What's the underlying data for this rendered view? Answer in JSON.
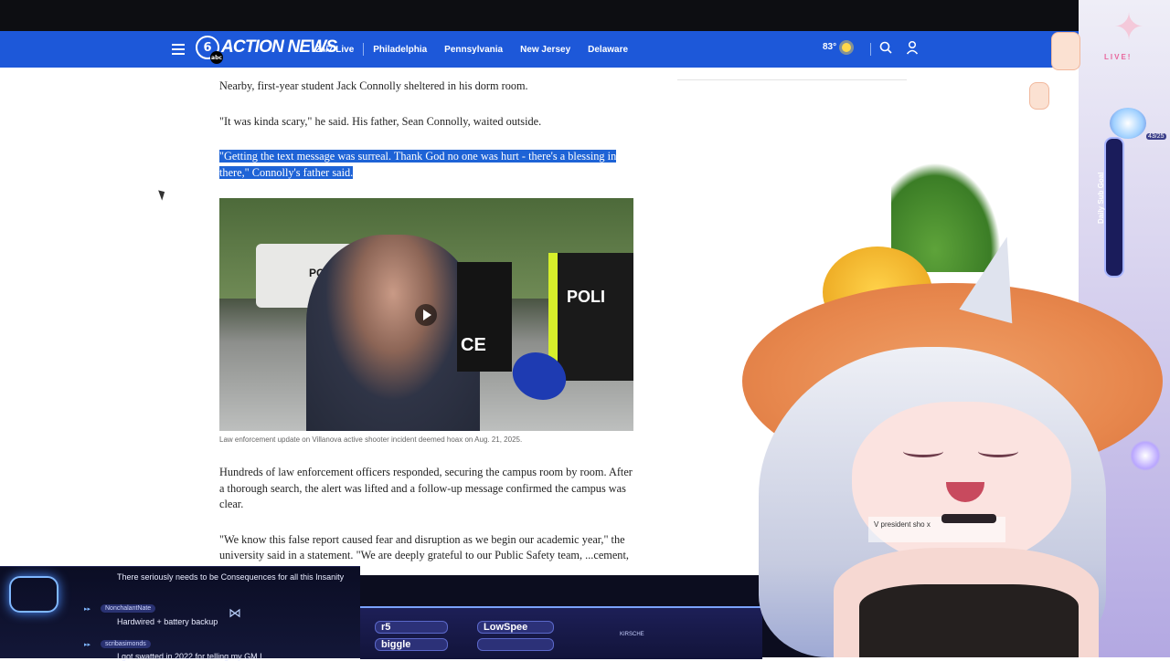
{
  "nav": {
    "logo_number": "6",
    "logo_sub": "abc",
    "logo_text": "ACTION NEWS",
    "links": [
      "24/7 Live",
      "Philadelphia",
      "Pennsylvania",
      "New Jersey",
      "Delaware"
    ],
    "temperature": "83°",
    "colors": {
      "nav_bg": "#1d58d9",
      "highlight": "#1e63d6"
    }
  },
  "article": {
    "p1": "Nearby, first-year student Jack Connolly sheltered in his dorm room.",
    "p2": "\"It was kinda scary,\" he said. His father, Sean Connolly, waited outside.",
    "p3_highlighted": "\"Getting the text message was surreal. Thank God no one was hurt - there's a blessing in there,\" Connolly's father said.",
    "caption": "Law enforcement update on Villanova active shooter incident deemed hoax on Aug. 21, 2025.",
    "video_sign_1": "POLICE",
    "video_sign_2": "POLI",
    "video_sign_3": "CE",
    "p4": "Hundreds of law enforcement officers responded, securing the campus room by room. After a thorough search, the alert was lifted and a follow-up message confirmed the campus was clear.",
    "p5": "\"We know this false report caused fear and disruption as we begin our academic year,\" the university said in a statement. \"We are deeply grateful to our Public Safety team, ...cement, and our staff and student leaders for responding"
  },
  "chat": [
    {
      "user": "",
      "message": "There seriously needs to be Consequences for all this Insanity"
    },
    {
      "user": "NonchalantNate",
      "message": "Hardwired + battery backup"
    },
    {
      "user": "scribasimonds",
      "message": "I got swatted in 2022 for telling my GM I"
    }
  ],
  "ticker": {
    "items": [
      "r5",
      "LowSpee",
      "biggle",
      "",
      "KIRSCHE"
    ]
  },
  "stream_overlay": {
    "live": "LIVE!",
    "goal_label": "Daily Sub Goal",
    "goal_count": "43/25",
    "badge_text": "V president sho",
    "badge_text_2": "x"
  }
}
